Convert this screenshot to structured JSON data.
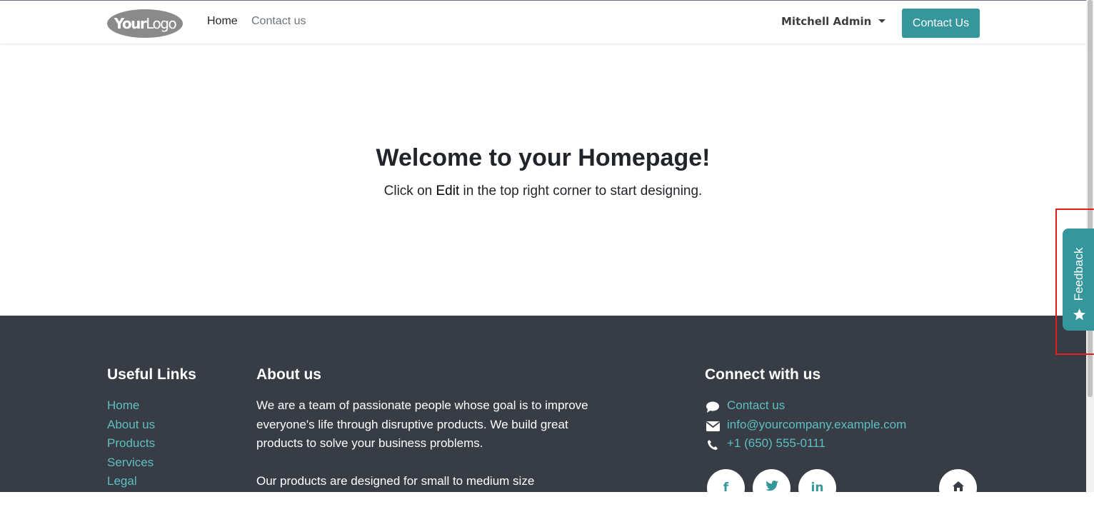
{
  "header": {
    "logo": {
      "bold": "Your",
      "light": "Logo"
    },
    "nav": [
      {
        "label": "Home",
        "active": true
      },
      {
        "label": "Contact us",
        "active": false
      }
    ],
    "user": "Mitchell Admin",
    "cta_label": "Contact Us"
  },
  "hero": {
    "title_pre": "Welcome to your ",
    "title_bold": "Homepage",
    "title_post": "!",
    "sub_pre": "Click on ",
    "sub_edit": "Edit",
    "sub_post": " in the top right corner to start designing."
  },
  "footer": {
    "useful_links": {
      "heading": "Useful Links",
      "links": [
        "Home",
        "About us",
        "Products",
        "Services",
        "Legal"
      ]
    },
    "about": {
      "heading": "About us",
      "lines_1": [
        "We are a team of passionate people whose goal is to improve",
        "everyone's life through disruptive products. We build great",
        "products to solve your business problems."
      ],
      "line_2": "Our products are designed for small to medium size"
    },
    "connect": {
      "heading": "Connect with us",
      "contact": "Contact us",
      "email": "info@yourcompany.example.com",
      "phone": "+1 (650) 555-0111",
      "social": [
        {
          "icon": "facebook-icon",
          "glyph": "f"
        },
        {
          "icon": "twitter-icon",
          "glyph": ""
        },
        {
          "icon": "linkedin-icon",
          "glyph": "in"
        },
        {
          "icon": "home-icon",
          "glyph": ""
        }
      ]
    }
  },
  "feedback": {
    "label": "Feedback"
  },
  "colors": {
    "accent": "#35979c",
    "footer_bg": "#383c44",
    "link": "#5dbfc4",
    "highlight": "#e0201b"
  }
}
